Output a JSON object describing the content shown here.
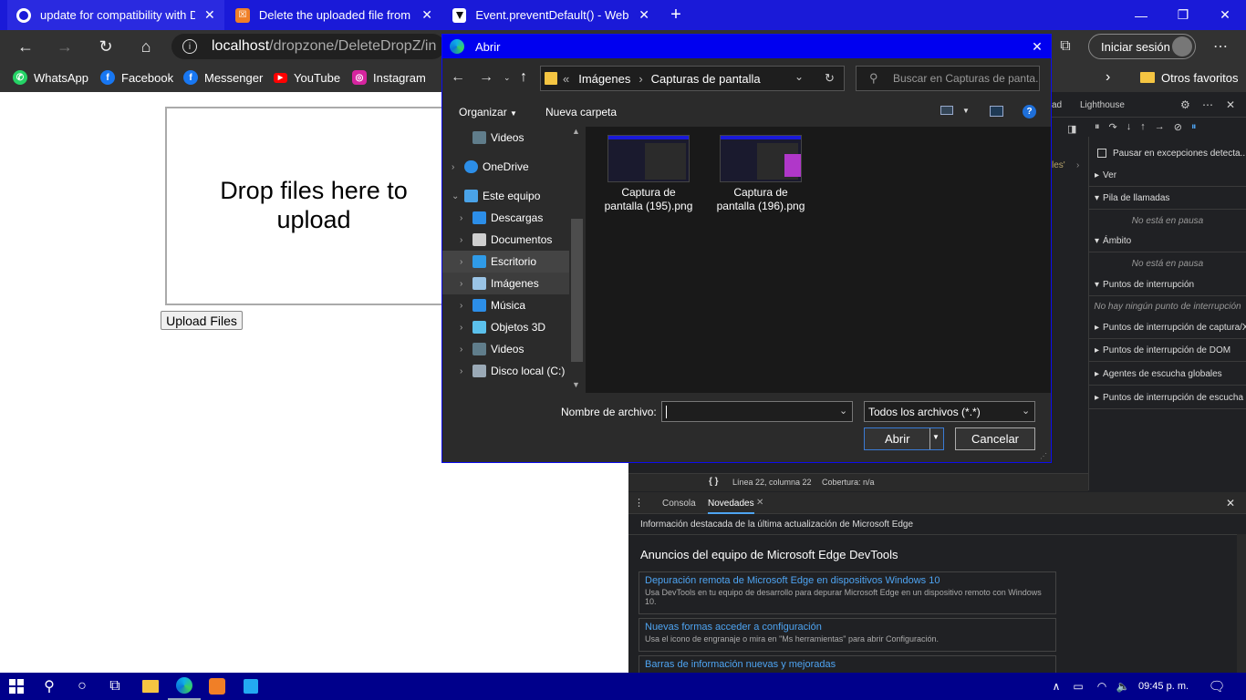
{
  "tabs": [
    {
      "title": "update for compatibility with Dr",
      "color": "#ffffff"
    },
    {
      "title": "Delete the uploaded file from Dr",
      "color": "#f07f27"
    },
    {
      "title": "Event.preventDefault() - Web AP",
      "color": "#1d1d1d"
    }
  ],
  "toolbar": {
    "url_host": "localhost",
    "url_path": "/dropzone/DeleteDropZ/in",
    "signin_label": "Iniciar sesión"
  },
  "bookmarks": [
    {
      "label": "WhatsApp",
      "icon": "whatsapp-icon",
      "color": "#25d366"
    },
    {
      "label": "Facebook",
      "icon": "facebook-icon",
      "color": "#1877f2"
    },
    {
      "label": "Messenger",
      "icon": "messenger-icon",
      "color": "#1877f2"
    },
    {
      "label": "YouTube",
      "icon": "youtube-icon",
      "color": "#ff0000"
    },
    {
      "label": "Instagram",
      "icon": "instagram-icon",
      "color": "#d6249f"
    }
  ],
  "other_favorites": "Otros favoritos",
  "page": {
    "drop_text": "Drop files here to upload",
    "upload_button": "Upload Files"
  },
  "dialog": {
    "title": "Abrir",
    "path": [
      "Imágenes",
      "Capturas de pantalla"
    ],
    "search_placeholder": "Buscar en Capturas de panta...",
    "organize": "Organizar",
    "new_folder": "Nueva carpeta",
    "nav_items": [
      {
        "label": "Videos",
        "icon": "video-folder-icon",
        "indent": 1,
        "chevron": false
      },
      {
        "label": "OneDrive",
        "icon": "onedrive-icon",
        "indent": 0,
        "chevron": true
      },
      {
        "label": "Este equipo",
        "icon": "computer-icon",
        "indent": 0,
        "chevron": true,
        "expanded": true
      },
      {
        "label": "Descargas",
        "icon": "download-folder-icon",
        "indent": 1,
        "chevron": true
      },
      {
        "label": "Documentos",
        "icon": "documents-folder-icon",
        "indent": 1,
        "chevron": true
      },
      {
        "label": "Escritorio",
        "icon": "desktop-folder-icon",
        "indent": 1,
        "chevron": true,
        "hover": true
      },
      {
        "label": "Imágenes",
        "icon": "pictures-folder-icon",
        "indent": 1,
        "chevron": true,
        "selected": true
      },
      {
        "label": "Música",
        "icon": "music-folder-icon",
        "indent": 1,
        "chevron": true
      },
      {
        "label": "Objetos 3D",
        "icon": "objects3d-folder-icon",
        "indent": 1,
        "chevron": true
      },
      {
        "label": "Videos",
        "icon": "video-folder-icon",
        "indent": 1,
        "chevron": true
      },
      {
        "label": "Disco local (C:)",
        "icon": "drive-icon",
        "indent": 1,
        "chevron": true
      }
    ],
    "files": [
      {
        "name": "Captura de pantalla (195).png"
      },
      {
        "name": "Captura de pantalla (196).png"
      }
    ],
    "filename_label": "Nombre de archivo:",
    "filename_value": "",
    "filetype": "Todos los archivos (*.*)",
    "open_button": "Abrir",
    "cancel_button": "Cancelar"
  },
  "devtools": {
    "tab_partial": "ad",
    "tab_lighthouse": "Lighthouse",
    "code_fragment": "les'",
    "pause_exceptions": "Pausar en excepciones detecta...",
    "sections": [
      {
        "label": "Ver",
        "open": false
      },
      {
        "label": "Pila de llamadas",
        "open": true,
        "sub": "No está en pausa"
      },
      {
        "label": "Ámbito",
        "open": true,
        "sub": "No está en pausa"
      },
      {
        "label": "Puntos de interrupción",
        "open": true,
        "sub": "No hay ningún punto de interrupción"
      },
      {
        "label": "Puntos de interrupción de captura/XH",
        "open": false
      },
      {
        "label": "Puntos de interrupción de DOM",
        "open": false
      },
      {
        "label": "Agentes de escucha globales",
        "open": false
      },
      {
        "label": "Puntos de interrupción de escucha de",
        "open": false
      }
    ],
    "status_line": "Línea 22, columna 22",
    "coverage": "Cobertura: n/a",
    "drawer_tabs": [
      "Consola",
      "Novedades"
    ],
    "highlights_title": "Información destacada de la última actualización de Microsoft Edge",
    "announcements_title": "Anuncios del equipo de Microsoft Edge DevTools",
    "cards": [
      {
        "title": "Depuración remota de Microsoft Edge en dispositivos Windows 10",
        "desc": "Usa DevTools en tu equipo de desarrollo para depurar Microsoft Edge en un dispositivo remoto con Windows 10."
      },
      {
        "title": "Nuevas formas acceder a configuración",
        "desc": "Usa el icono de engranaje o mira en \"Ms herramientas\" para abrir Configuración."
      },
      {
        "title": "Barras de información nuevas y mejoradas",
        "desc": ""
      }
    ]
  },
  "taskbar": {
    "time": "09:45 p. m."
  }
}
